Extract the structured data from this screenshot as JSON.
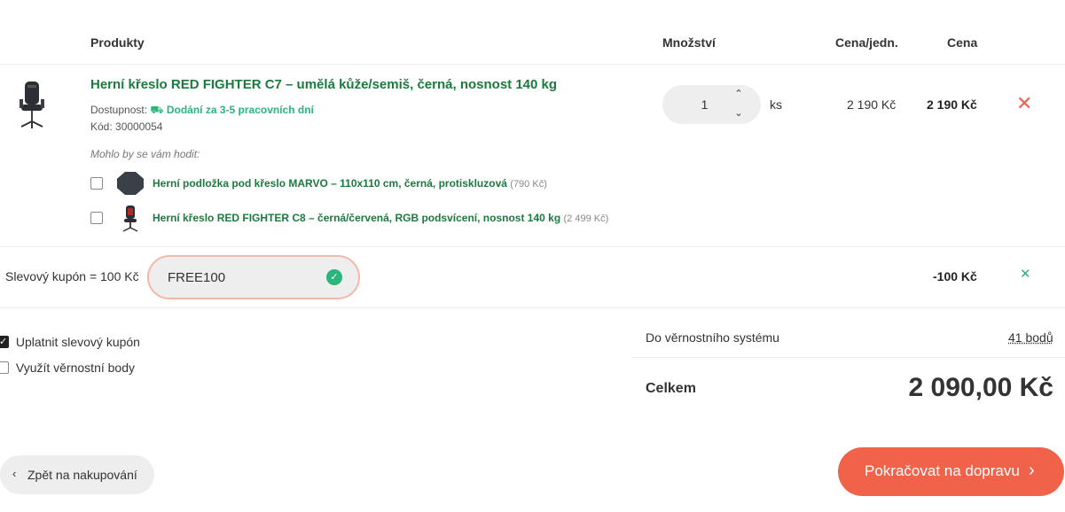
{
  "header": {
    "products": "Produkty",
    "quantity": "Množství",
    "unit_price": "Cena/jedn.",
    "price": "Cena"
  },
  "item": {
    "name": "Herní křeslo RED FIGHTER C7 – umělá kůže/semiš, černá, nosnost 140 kg",
    "availability_label": "Dostupnost:",
    "availability_value": "Dodání za 3-5 pracovních dní",
    "code": "Kód: 30000054",
    "quantity": "1",
    "unit": "ks",
    "unit_price": "2 190 Kč",
    "total_price": "2 190 Kč"
  },
  "suggestions": {
    "title": "Mohlo by se vám hodit:",
    "items": [
      {
        "name": "Herní podložka pod křeslo MARVO – 110x110 cm, černá, protiskluzová",
        "price": "(790 Kč)"
      },
      {
        "name": "Herní křeslo RED FIGHTER C8 – černá/červená, RGB podsvícení, nosnost 140 kg",
        "price": "(2 499 Kč)"
      }
    ]
  },
  "coupon": {
    "label": "Slevový kupón = 100 Kč",
    "value": "FREE100",
    "discount": "-100 Kč"
  },
  "options": {
    "apply_coupon": "Uplatnit slevový kupón",
    "use_points": "Využít věrnostní body"
  },
  "summary": {
    "loyalty_label": "Do věrnostního systému",
    "loyalty_value": "41 bodů",
    "total_label": "Celkem",
    "total_value": "2 090,00 Kč"
  },
  "buttons": {
    "back": "Zpět na nakupování",
    "next": "Pokračovat na dopravu"
  },
  "colors": {
    "accent": "#f0624a",
    "link_green": "#1b7a3e",
    "success": "#2ab57d"
  }
}
